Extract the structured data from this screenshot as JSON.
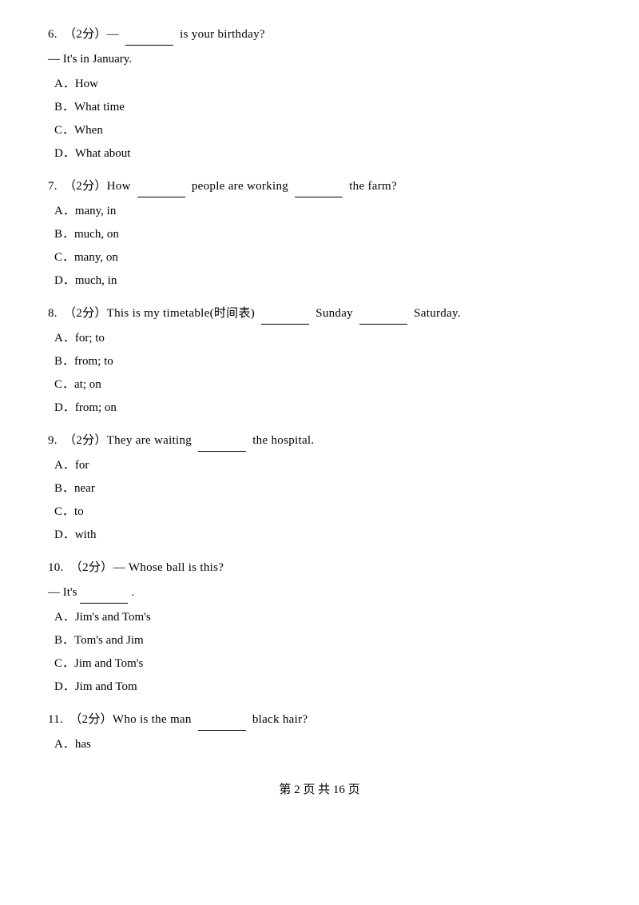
{
  "questions": [
    {
      "number": "6.",
      "score": "（2分）",
      "text_before_blank": "—",
      "blank": true,
      "text_after_blank": "is your birthday?",
      "answer_line": "— It's in January.",
      "options": [
        {
          "label": "A",
          "text": "How"
        },
        {
          "label": "B",
          "text": "What time"
        },
        {
          "label": "C",
          "text": "When"
        },
        {
          "label": "D",
          "text": "What about"
        }
      ]
    },
    {
      "number": "7.",
      "score": "（2分）",
      "text_before_blank": "How",
      "blank": true,
      "text_after_blank": "people are working",
      "blank2": true,
      "text_after_blank2": "the farm?",
      "options": [
        {
          "label": "A",
          "text": "many, in"
        },
        {
          "label": "B",
          "text": "much, on"
        },
        {
          "label": "C",
          "text": "many, on"
        },
        {
          "label": "D",
          "text": "much, in"
        }
      ]
    },
    {
      "number": "8.",
      "score": "（2分）",
      "text_before_blank": "This is my timetable(时间表)",
      "blank": true,
      "text_middle": "Sunday",
      "blank2": true,
      "text_after_blank2": "Saturday.",
      "options": [
        {
          "label": "A",
          "text": "for; to"
        },
        {
          "label": "B",
          "text": "from; to"
        },
        {
          "label": "C",
          "text": "at; on"
        },
        {
          "label": "D",
          "text": "from; on"
        }
      ]
    },
    {
      "number": "9.",
      "score": "（2分）",
      "text_before_blank": "They are waiting",
      "blank": true,
      "text_after_blank": "the hospital.",
      "options": [
        {
          "label": "A",
          "text": "for"
        },
        {
          "label": "B",
          "text": "near"
        },
        {
          "label": "C",
          "text": "to"
        },
        {
          "label": "D",
          "text": "with"
        }
      ]
    },
    {
      "number": "10.",
      "score": "（2分）",
      "text_before_blank": "— Whose ball is this?",
      "answer_line_prefix": "— It's",
      "answer_blank": true,
      "answer_suffix": ".",
      "options": [
        {
          "label": "A",
          "text": "Jim's and Tom's"
        },
        {
          "label": "B",
          "text": "Tom's and Jim"
        },
        {
          "label": "C",
          "text": "Jim and Tom's"
        },
        {
          "label": "D",
          "text": "Jim and Tom"
        }
      ]
    },
    {
      "number": "11.",
      "score": "（2分）",
      "text_before_blank": "Who is the man",
      "blank": true,
      "text_after_blank": "black hair?",
      "options": [
        {
          "label": "A",
          "text": "has"
        }
      ]
    }
  ],
  "footer": {
    "text": "第 2 页 共 16 页"
  }
}
